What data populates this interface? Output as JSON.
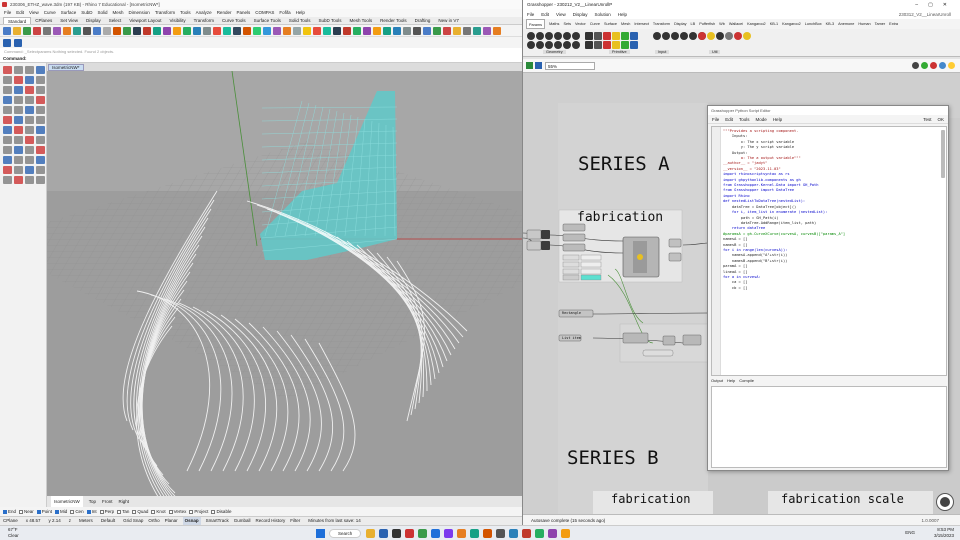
{
  "rhino": {
    "title": "230306_ETHZ_wave.3dm (197 KB) - Rhino 7 Educational - [IsometricNW*]",
    "menu": [
      "File",
      "Edit",
      "View",
      "Curve",
      "Surface",
      "SubD",
      "Solid",
      "Mesh",
      "Dimension",
      "Transform",
      "Tools",
      "Analyze",
      "Render",
      "Panels",
      "COMPAS",
      "Fofifa",
      "Help"
    ],
    "tabs": [
      "Standard",
      "CPlanes",
      "Set View",
      "Display",
      "Select",
      "Viewport Layout",
      "Visibility",
      "Transform",
      "Curve Tools",
      "Surface Tools",
      "Solid Tools",
      "SubD Tools",
      "Mesh Tools",
      "Render Tools",
      "Drafting",
      "New in V7"
    ],
    "active_tab": "Standard",
    "command_history": "Command: _Selectparams  Nothing selected. Found 2 objects.",
    "command_label": "Command:",
    "viewport_name": "IsometricNW*",
    "viewport_tabs": [
      "IsometricNW",
      "Top",
      "Front",
      "Right"
    ],
    "osnaps": [
      {
        "label": "End",
        "on": true
      },
      {
        "label": "Near",
        "on": false
      },
      {
        "label": "Point",
        "on": true
      },
      {
        "label": "Mid",
        "on": true
      },
      {
        "label": "Cen",
        "on": false
      },
      {
        "label": "Int",
        "on": true
      },
      {
        "label": "Perp",
        "on": false
      },
      {
        "label": "Tan",
        "on": false
      },
      {
        "label": "Quad",
        "on": false
      },
      {
        "label": "Knot",
        "on": false
      },
      {
        "label": "Vertex",
        "on": false
      },
      {
        "label": "Project",
        "on": false
      },
      {
        "label": "Disable",
        "on": false
      }
    ],
    "status": {
      "cplane": "CPlane",
      "x": "x 48.57",
      "y": "y 2.14",
      "z": "z",
      "units": "Meters",
      "layer": "Default",
      "items": [
        "Grid Snap",
        "Ortho",
        "Planar",
        "Osnap",
        "SmartTrack",
        "Gumball",
        "Record History",
        "Filter"
      ],
      "highlighted": "Osnap",
      "message": "Minutes from last save: 14"
    }
  },
  "grasshopper": {
    "title": "Grasshopper - 230212_V2__LinearUnrollP",
    "menu": [
      "File",
      "Edit",
      "View",
      "Display",
      "Solution",
      "Help"
    ],
    "menu_right": "230312_V2__LinearUnroll",
    "tabs": [
      "Params",
      "Maths",
      "Sets",
      "Vector",
      "Curve",
      "Surface",
      "Mesh",
      "Intersect",
      "Transform",
      "Display",
      "LB",
      "Pufferfish",
      "Wb",
      "Wallacei",
      "Kangaroo2",
      "KB-1",
      "Kangaroo2",
      "LunchBox",
      "KB-3",
      "Anemone",
      "Human",
      "Tamer",
      "Extra"
    ],
    "active_tab": "Params",
    "ribbon_groups": [
      "Geometry",
      "Primitive",
      "Input",
      "Util"
    ],
    "zoom": "55%",
    "canvas": {
      "group_series_a": "SERIES A",
      "group_series_b": "SERIES B",
      "fabrication": "fabrication",
      "fabrication_b": "fabrication",
      "fabrication_scale": "fabrication scale",
      "param_label_1": "Rectangle",
      "param_label_2": "List item"
    },
    "status": "Autosave complete (15 seconds ago)",
    "version": "1.0.0007"
  },
  "python_editor": {
    "title": "Grasshopper Python Script Editor",
    "menu": [
      "File",
      "Edit",
      "Tools",
      "Mode",
      "Help"
    ],
    "menu_right": [
      "Test",
      "OK"
    ],
    "code_lines": [
      "\"\"\"Provides a scripting component.",
      "    Inputs:",
      "        x: The x script variable",
      "        y: The y script variable",
      "    Output:",
      "        a: The a output variable\"\"\"",
      "",
      "__author__ = \"jadyt\"",
      "__version__ = \"2023.11.03\"",
      "",
      "",
      "import rhinoscriptsyntax as rs",
      "import ghpythonlib.components as gh",
      "from Grasshopper.Kernel.Data import GH_Path",
      "from Grasshopper import DataTree",
      "import Rhino",
      "",
      "",
      "",
      "",
      "def nestedListToDataTree(nestedList):",
      "    dataTree = DataTree[object]()",
      "    for i, item_list in enumerate (nestedList):",
      "        path = GH_Path(i)",
      "        dataTree.AddRange(item_list, path)",
      "    return dataTree",
      "",
      "",
      "",
      "#paramsA = gh.CurveXCurve(curvesA, curvesB)[\"params_A\"]",
      "",
      "namesA = []",
      "namesB = []",
      "for i in range(len(curvesA)):",
      "    namesA.append(\"A\"+str(i))",
      "    namesB.append(\"B\"+str(i))",
      "",
      "paramA = []",
      "lineaA = []",
      "for a in curvesA:",
      "    ca = []",
      "    cb = []"
    ],
    "output_tabs": [
      "Output",
      "Help",
      "Compile"
    ]
  },
  "taskbar": {
    "weather_temp": "67°F",
    "weather_desc": "Clear",
    "search": "Search",
    "lang": "ENG",
    "time": "8:53 PM",
    "date": "3/15/2023"
  }
}
